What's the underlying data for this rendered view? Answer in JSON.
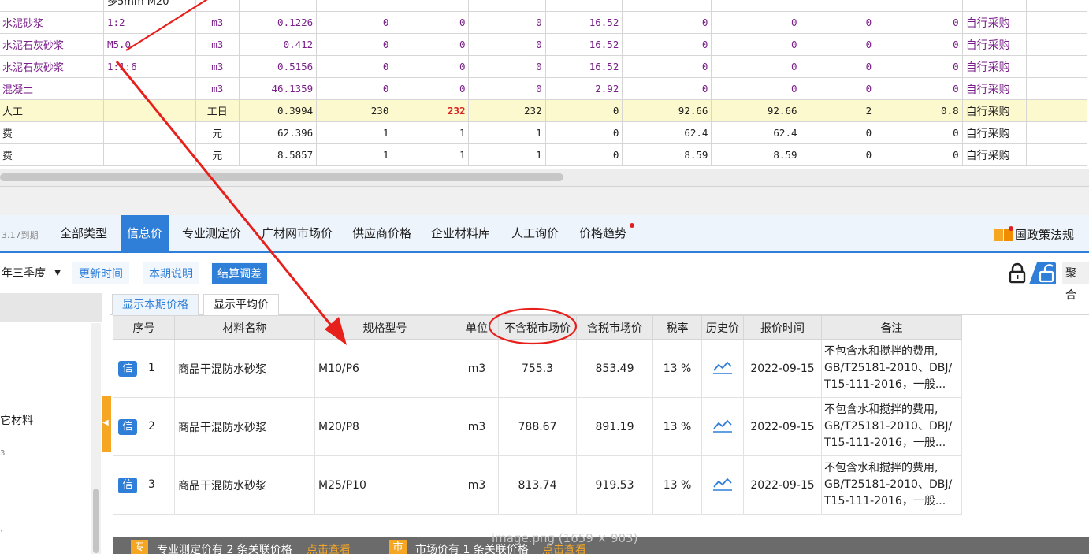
{
  "top_grid": {
    "partial_row_spec": "多5mm M20",
    "rows": [
      {
        "name": "水泥砂浆",
        "spec": "1:2",
        "unit": "m3",
        "qty": "0.1226",
        "c1": "0",
        "c2": "0",
        "c3": "0",
        "c4": "16.52",
        "c5": "0",
        "c6": "0",
        "c7": "0",
        "c8": "0",
        "source": "自行采购",
        "style": "purple"
      },
      {
        "name": "水泥石灰砂浆",
        "spec": "M5.0",
        "unit": "m3",
        "qty": "0.412",
        "c1": "0",
        "c2": "0",
        "c3": "0",
        "c4": "16.52",
        "c5": "0",
        "c6": "0",
        "c7": "0",
        "c8": "0",
        "source": "自行采购",
        "style": "purple"
      },
      {
        "name": "水泥石灰砂浆",
        "spec": "1:1:6",
        "unit": "m3",
        "qty": "0.5156",
        "c1": "0",
        "c2": "0",
        "c3": "0",
        "c4": "16.52",
        "c5": "0",
        "c6": "0",
        "c7": "0",
        "c8": "0",
        "source": "自行采购",
        "style": "purple"
      },
      {
        "name": "混凝土",
        "spec": "",
        "unit": "m3",
        "qty": "46.1359",
        "c1": "0",
        "c2": "0",
        "c3": "0",
        "c4": "2.92",
        "c5": "0",
        "c6": "0",
        "c7": "0",
        "c8": "0",
        "source": "自行采购",
        "style": "purple"
      },
      {
        "name": "人工",
        "spec": "",
        "unit": "工日",
        "qty": "0.3994",
        "c1": "230",
        "c2": "232",
        "c3": "232",
        "c4": "0",
        "c5": "92.66",
        "c6": "92.66",
        "c7": "2",
        "c8": "0.8",
        "source": "自行采购",
        "style": "yellow"
      },
      {
        "name": "费",
        "spec": "",
        "unit": "元",
        "qty": "62.396",
        "c1": "1",
        "c2": "1",
        "c3": "1",
        "c4": "0",
        "c5": "62.4",
        "c6": "62.4",
        "c7": "0",
        "c8": "0",
        "source": "自行采购",
        "style": "plain"
      },
      {
        "name": "费",
        "spec": "",
        "unit": "元",
        "qty": "8.5857",
        "c1": "1",
        "c2": "1",
        "c3": "1",
        "c4": "0",
        "c5": "8.59",
        "c6": "8.59",
        "c7": "0",
        "c8": "0",
        "source": "自行采购",
        "style": "plain"
      }
    ]
  },
  "tab_bar": {
    "date_note": "3.17到期",
    "tabs": [
      "全部类型",
      "信息价",
      "专业测定价",
      "广材网市场价",
      "供应商价格",
      "企业材料库",
      "人工询价",
      "价格趋势"
    ],
    "active_tab": "信息价",
    "policy_label": "国政策法规"
  },
  "toolbar": {
    "quarter": "年三季度",
    "update_time": "更新时间",
    "period_note": "本期说明",
    "settle_adjust": "结算调差",
    "aggregate": "聚合"
  },
  "left_panel": {
    "category": "它材料"
  },
  "sub_tabs": [
    "显示本期价格",
    "显示平均价"
  ],
  "price_table": {
    "headers": [
      "序号",
      "材料名称",
      "规格型号",
      "单位",
      "不含税市场价",
      "含税市场价",
      "税率",
      "历史价",
      "报价时间",
      "备注"
    ],
    "badge": "信",
    "rows": [
      {
        "seq": "1",
        "name": "商品干混防水砂浆",
        "spec": "M10/P6",
        "unit": "m3",
        "price_ex_tax": "755.3",
        "price_in_tax": "853.49",
        "tax": "13 %",
        "date": "2022-09-15",
        "note": [
          "不包含水和搅拌的费用,",
          "GB/T25181-2010、DBJ/",
          "T15-111-2016，一般..."
        ]
      },
      {
        "seq": "2",
        "name": "商品干混防水砂浆",
        "spec": "M20/P8",
        "unit": "m3",
        "price_ex_tax": "788.67",
        "price_in_tax": "891.19",
        "tax": "13 %",
        "date": "2022-09-15",
        "note": [
          "不包含水和搅拌的费用,",
          "GB/T25181-2010、DBJ/",
          "T15-111-2016，一般..."
        ]
      },
      {
        "seq": "3",
        "name": "商品干混防水砂浆",
        "spec": "M25/P10",
        "unit": "m3",
        "price_ex_tax": "813.74",
        "price_in_tax": "919.53",
        "tax": "13 %",
        "date": "2022-09-15",
        "note": [
          "不包含水和搅拌的费用,",
          "GB/T25181-2010、DBJ/",
          "T15-111-2016，一般..."
        ]
      }
    ]
  },
  "footer": {
    "chip1": "专",
    "text1": "专业测定价有 2 条关联价格",
    "link1": "点击查看",
    "chip2": "市",
    "text2": "市场价有 1 条关联价格",
    "link2": "点击查看"
  },
  "watermark": "image.png (1659 × 903)",
  "colors": {
    "accent": "#2f7fd8",
    "annotation_red": "#e8201c",
    "material_purple": "#7a1f8a",
    "highlight_yellow": "#fdf9cf",
    "orange": "#f5a623"
  }
}
